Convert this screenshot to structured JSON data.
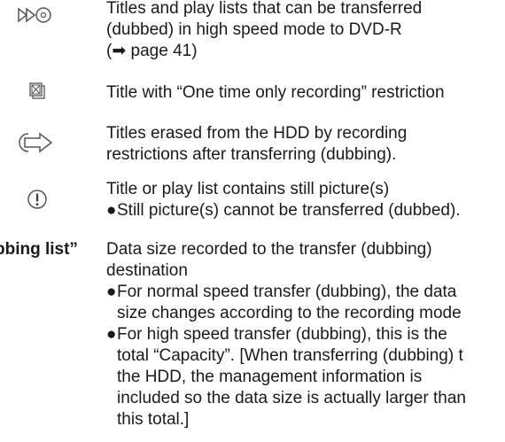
{
  "entries": [
    {
      "icon": "high-speed-dubbing-icon",
      "lines": [
        "Titles and play lists that can be transferred",
        "(dubbed) in high speed mode to DVD-R",
        "(➡ page 41)"
      ]
    },
    {
      "icon": "one-time-recording-icon",
      "lines": [
        "Title with “One time only recording” restriction"
      ]
    },
    {
      "icon": "erased-after-dubbing-icon",
      "lines": [
        "Titles erased from the HDD by recording",
        "restrictions after transferring (dubbing)."
      ]
    },
    {
      "icon": "still-picture-icon",
      "lines": [
        "Title or play list contains still picture(s)"
      ],
      "bullet": "Still picture(s) cannot be transferred (dubbed)."
    }
  ],
  "dubbing": {
    "label": "bbing list”",
    "lines": [
      "Data size recorded to the transfer (dubbing)",
      "destination"
    ],
    "bullets": [
      [
        "For normal speed transfer (dubbing), the data",
        "size changes according to the recording mode"
      ],
      [
        "For high speed transfer (dubbing), this is the",
        "total “Capacity”. [When transferring (dubbing) t",
        "the HDD, the management information is",
        "included so the data size is actually larger than",
        "this total.]"
      ]
    ]
  },
  "bullet_char": "●"
}
